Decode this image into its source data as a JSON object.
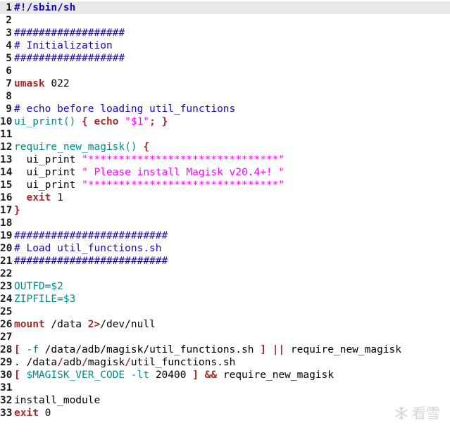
{
  "editor": {
    "current_line": 1,
    "lines": [
      {
        "n": "1",
        "tokens": [
          {
            "t": "#!/sbin/sh",
            "c": "shebang"
          }
        ]
      },
      {
        "n": "2",
        "tokens": []
      },
      {
        "n": "3",
        "tokens": [
          {
            "t": "##################",
            "c": "comment"
          }
        ]
      },
      {
        "n": "4",
        "tokens": [
          {
            "t": "# Initialization",
            "c": "comment"
          }
        ]
      },
      {
        "n": "5",
        "tokens": [
          {
            "t": "##################",
            "c": "comment"
          }
        ]
      },
      {
        "n": "6",
        "tokens": []
      },
      {
        "n": "7",
        "tokens": [
          {
            "t": "umask",
            "c": "keyword"
          },
          {
            "t": " 022",
            "c": "plain"
          }
        ]
      },
      {
        "n": "8",
        "tokens": []
      },
      {
        "n": "9",
        "tokens": [
          {
            "t": "# echo before loading util_functions",
            "c": "comment"
          }
        ]
      },
      {
        "n": "10",
        "tokens": [
          {
            "t": "ui_print()",
            "c": "func"
          },
          {
            "t": " ",
            "c": "plain"
          },
          {
            "t": "{",
            "c": "bracket"
          },
          {
            "t": " ",
            "c": "plain"
          },
          {
            "t": "echo",
            "c": "keyword"
          },
          {
            "t": " ",
            "c": "plain"
          },
          {
            "t": "\"$1\"",
            "c": "string"
          },
          {
            "t": "; ",
            "c": "keyword"
          },
          {
            "t": "}",
            "c": "bracket"
          }
        ]
      },
      {
        "n": "11",
        "tokens": []
      },
      {
        "n": "12",
        "tokens": [
          {
            "t": "require_new_magisk()",
            "c": "func"
          },
          {
            "t": " ",
            "c": "plain"
          },
          {
            "t": "{",
            "c": "bracket"
          }
        ]
      },
      {
        "n": "13",
        "tokens": [
          {
            "t": "  ui_print ",
            "c": "plain"
          },
          {
            "t": "\"*******************************\"",
            "c": "string"
          }
        ]
      },
      {
        "n": "14",
        "tokens": [
          {
            "t": "  ui_print ",
            "c": "plain"
          },
          {
            "t": "\" Please install Magisk v20.4+! \"",
            "c": "string"
          }
        ]
      },
      {
        "n": "15",
        "tokens": [
          {
            "t": "  ui_print ",
            "c": "plain"
          },
          {
            "t": "\"*******************************\"",
            "c": "string"
          }
        ]
      },
      {
        "n": "16",
        "tokens": [
          {
            "t": "  ",
            "c": "plain"
          },
          {
            "t": "exit",
            "c": "keyword"
          },
          {
            "t": " 1",
            "c": "plain"
          }
        ]
      },
      {
        "n": "17",
        "tokens": [
          {
            "t": "}",
            "c": "bracket"
          }
        ]
      },
      {
        "n": "18",
        "tokens": []
      },
      {
        "n": "19",
        "tokens": [
          {
            "t": "#########################",
            "c": "comment"
          }
        ]
      },
      {
        "n": "20",
        "tokens": [
          {
            "t": "# Load util_functions.sh",
            "c": "comment"
          }
        ]
      },
      {
        "n": "21",
        "tokens": [
          {
            "t": "#########################",
            "c": "comment"
          }
        ]
      },
      {
        "n": "22",
        "tokens": []
      },
      {
        "n": "23",
        "tokens": [
          {
            "t": "OUTFD=$2",
            "c": "var"
          }
        ]
      },
      {
        "n": "24",
        "tokens": [
          {
            "t": "ZIPFILE=$3",
            "c": "var"
          }
        ]
      },
      {
        "n": "25",
        "tokens": []
      },
      {
        "n": "26",
        "tokens": [
          {
            "t": "mount",
            "c": "keyword"
          },
          {
            "t": " /data ",
            "c": "plain"
          },
          {
            "t": "2>",
            "c": "keyword"
          },
          {
            "t": "/dev/null",
            "c": "plain"
          }
        ]
      },
      {
        "n": "27",
        "tokens": []
      },
      {
        "n": "28",
        "tokens": [
          {
            "t": "[",
            "c": "bracket"
          },
          {
            "t": " ",
            "c": "plain"
          },
          {
            "t": "-f",
            "c": "var"
          },
          {
            "t": " /data/adb/magisk/util_functions.sh ",
            "c": "plain"
          },
          {
            "t": "]",
            "c": "bracket"
          },
          {
            "t": " ",
            "c": "plain"
          },
          {
            "t": "||",
            "c": "keyword"
          },
          {
            "t": " require_new_magisk",
            "c": "plain"
          }
        ]
      },
      {
        "n": "29",
        "tokens": [
          {
            "t": ". /data",
            "c": "plain"
          },
          {
            "t": "/",
            "c": "keyword"
          },
          {
            "t": "adb",
            "c": "plain"
          },
          {
            "t": "/",
            "c": "keyword"
          },
          {
            "t": "magisk",
            "c": "plain"
          },
          {
            "t": "/",
            "c": "keyword"
          },
          {
            "t": "util_functions.sh",
            "c": "plain"
          }
        ]
      },
      {
        "n": "30",
        "tokens": [
          {
            "t": "[",
            "c": "bracket"
          },
          {
            "t": " ",
            "c": "plain"
          },
          {
            "t": "$MAGISK_VER_CODE",
            "c": "var"
          },
          {
            "t": " ",
            "c": "plain"
          },
          {
            "t": "-lt",
            "c": "var"
          },
          {
            "t": " 20400 ",
            "c": "plain"
          },
          {
            "t": "]",
            "c": "bracket"
          },
          {
            "t": " ",
            "c": "plain"
          },
          {
            "t": "&&",
            "c": "keyword"
          },
          {
            "t": " require_new_magisk",
            "c": "plain"
          }
        ]
      },
      {
        "n": "31",
        "tokens": []
      },
      {
        "n": "32",
        "tokens": [
          {
            "t": "install_module",
            "c": "plain"
          }
        ]
      },
      {
        "n": "33",
        "tokens": [
          {
            "t": "exit",
            "c": "keyword"
          },
          {
            "t": " 0",
            "c": "plain"
          }
        ]
      }
    ]
  },
  "watermark": {
    "text": "看雪",
    "icon": "snowflake-icon"
  }
}
